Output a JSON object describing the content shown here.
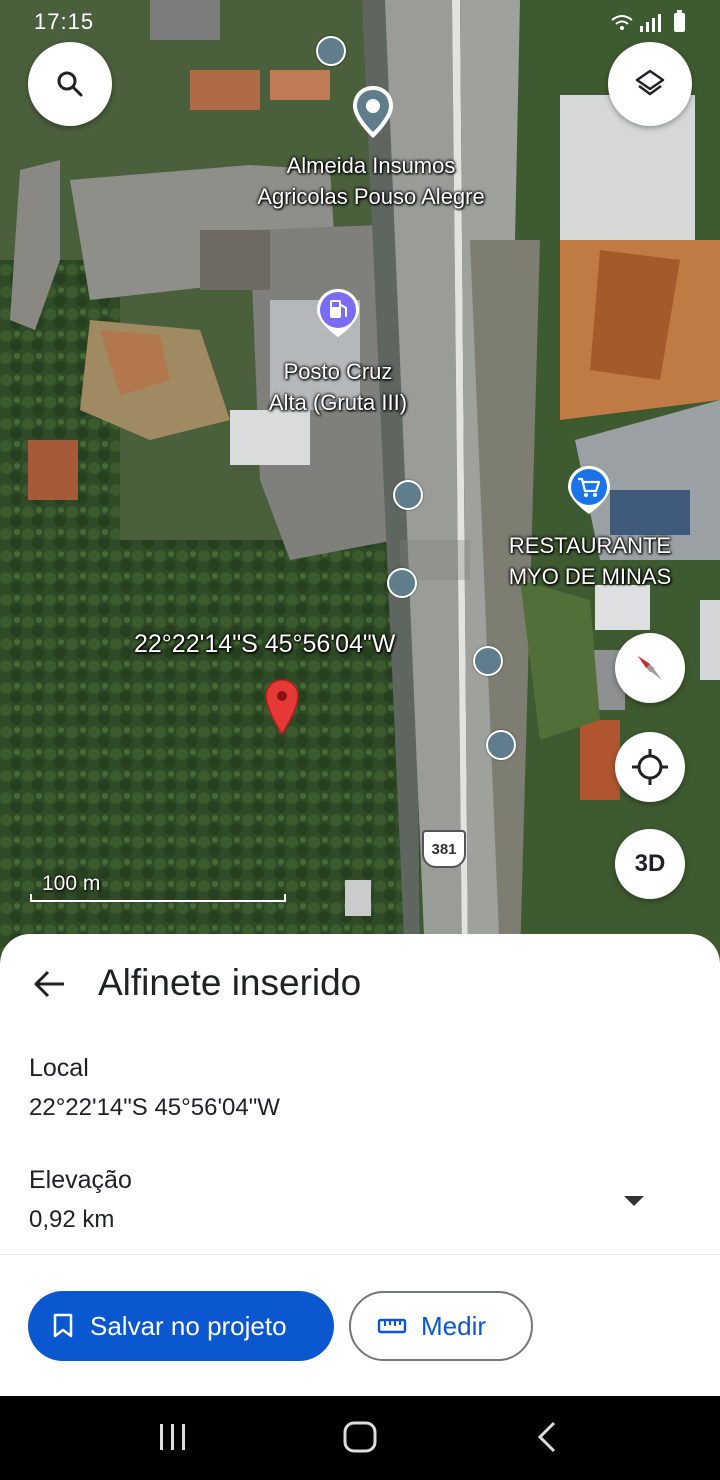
{
  "status_bar": {
    "time": "17:15"
  },
  "map": {
    "places": [
      {
        "name_line1": "Almeida Insumos",
        "name_line2": "Agricolas Pouso Alegre",
        "icon": "place-pin-icon"
      },
      {
        "name_line1": "Posto Cruz",
        "name_line2": "Alta (Gruta III)",
        "icon": "gas-station-icon"
      },
      {
        "name_line1": "RESTAURANTE",
        "name_line2": "MYO DE MINAS",
        "icon": "shopping-cart-icon"
      }
    ],
    "dropped_pin_coords": "22°22'14\"S 45°56'04\"W",
    "route_shield": "381",
    "scale_label": "100 m",
    "buttons": {
      "search_icon": "search-icon",
      "layers_icon": "layers-icon",
      "compass_icon": "compass-icon",
      "locate_icon": "my-location-icon",
      "three_d_label": "3D"
    }
  },
  "sheet": {
    "title": "Alfinete inserido",
    "location_label": "Local",
    "location_value": "22°22'14\"S 45°56'04\"W",
    "elevation_label": "Elevação",
    "elevation_value": "0,92 km",
    "save_button": "Salvar no projeto",
    "measure_button": "Medir"
  },
  "colors": {
    "accent": "#0b57d0",
    "pin_red": "#e53935",
    "cart_blue": "#1a73e8"
  }
}
